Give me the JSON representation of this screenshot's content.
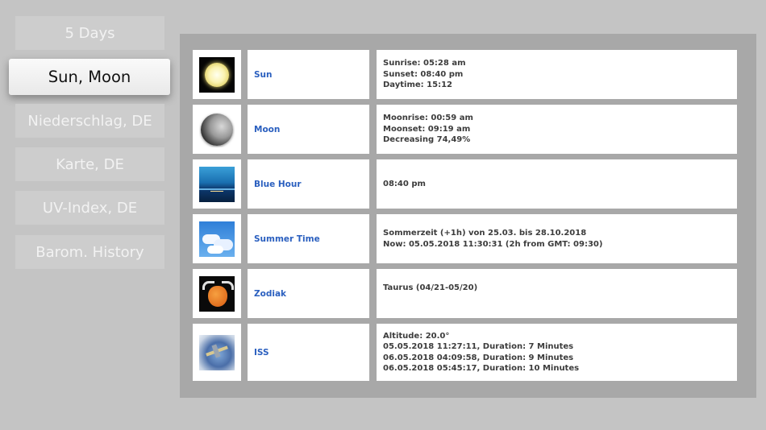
{
  "menu": [
    {
      "label": "5 Days",
      "active": false
    },
    {
      "label": "Sun, Moon",
      "active": true
    },
    {
      "label": "Niederschlag, DE",
      "active": false
    },
    {
      "label": "Karte, DE",
      "active": false
    },
    {
      "label": "UV-Index, DE",
      "active": false
    },
    {
      "label": "Barom. History",
      "active": false
    }
  ],
  "rows": [
    {
      "icon": "sun-icon",
      "name": "Sun",
      "lines": [
        "Sunrise: 05:28 am",
        "Sunset: 08:40 pm",
        "Daytime: 15:12"
      ]
    },
    {
      "icon": "moon-icon",
      "name": "Moon",
      "lines": [
        "Moonrise: 00:59 am",
        "Moonset: 09:19 am",
        "Decreasing 74,49%"
      ]
    },
    {
      "icon": "blue-hour-icon",
      "name": "Blue Hour",
      "lines": [
        "08:40 pm"
      ]
    },
    {
      "icon": "sky-clouds-icon",
      "name": "Summer Time",
      "lines": [
        "Sommerzeit (+1h) von 25.03. bis 28.10.2018",
        "Now: 05.05.2018 11:30:31 (2h from GMT: 09:30)"
      ]
    },
    {
      "icon": "taurus-bull-icon",
      "name": "Zodiak",
      "lines": [
        "Taurus (04/21-05/20)"
      ]
    },
    {
      "icon": "iss-station-icon",
      "name": "ISS",
      "lines": [
        "Altitude: 20.0°",
        "05.05.2018 11:27:11, Duration: 7 Minutes",
        "06.05.2018 04:09:58, Duration: 9 Minutes",
        "06.05.2018 05:45:17, Duration: 10 Minutes"
      ]
    }
  ],
  "colors": {
    "background": "#c4c4c4",
    "panel": "#a8a8a8",
    "link": "#2a5fbf"
  }
}
